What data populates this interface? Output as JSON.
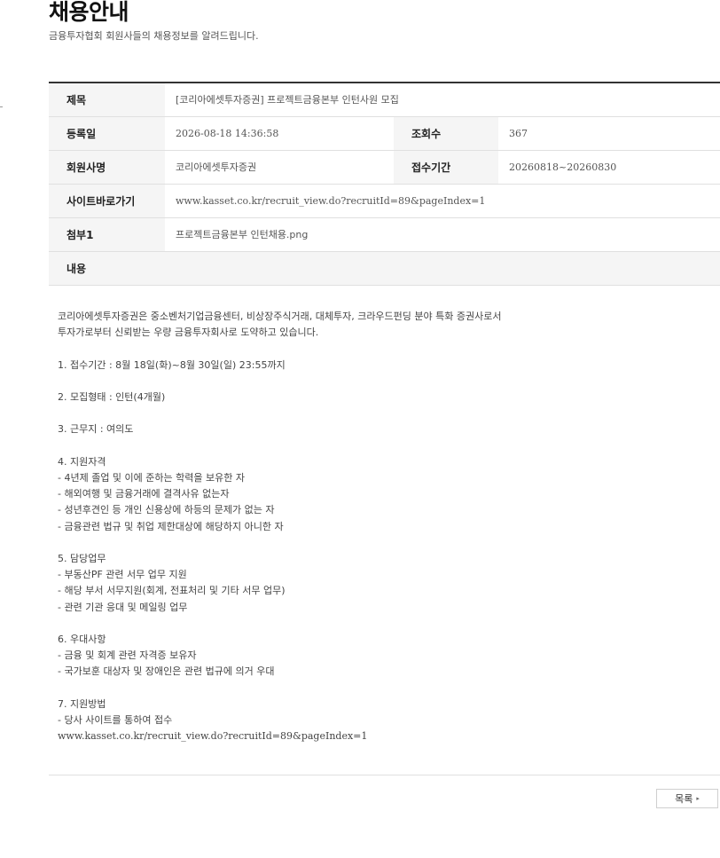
{
  "header": {
    "title": "채용안내",
    "subtitle": "금융투자협회 회원사들의 채용정보를 알려드립니다."
  },
  "detail": {
    "title_label": "제목",
    "title_value": "[코리아에셋투자증권] 프로젝트금융본부 인턴사원 모집",
    "date_label": "등록일",
    "date_value": "2026-08-18 14:36:58",
    "views_label": "조회수",
    "views_value": "367",
    "company_label": "회원사명",
    "company_value": "코리아에셋투자증권",
    "period_label": "접수기간",
    "period_value": "20260818~20260830",
    "site_label": "사이트바로가기",
    "site_value": "www.kasset.co.kr/recruit_view.do?recruitId=89&pageIndex=1",
    "attach_label": "첨부1",
    "attach_value": "프로젝트금융본부 인턴채용.png",
    "content_label": "내용"
  },
  "content": {
    "intro_1": "코리아에셋투자증권은 중소벤처기업금융센터, 비상장주식거래, 대체투자, 크라우드펀딩 분야 특화 증권사로서",
    "intro_2": "투자가로부터 신뢰받는 우량 금융투자회사로 도약하고 있습니다.",
    "s1": "1. 접수기간 : 8월 18일(화)~8월 30일(일) 23:55까지",
    "s2": "2. 모집형태 : 인턴(4개월)",
    "s3": "3. 근무지 : 여의도",
    "s4_title": "4. 지원자격",
    "s4_1": "- 4년제 졸업 및 이에 준하는 학력을 보유한 자",
    "s4_2": "- 해외여행 및 금융거래에 결격사유 없는자",
    "s4_3": "- 성년후견인 등 개인 신용상에 하등의 문제가 없는 자",
    "s4_4": "- 금융관련 법규 및 취업 제한대상에 해당하지 아니한 자",
    "s5_title": "5. 담당업무",
    "s5_1": "- 부동산PF 관련 서무 업무 지원",
    "s5_2": "- 해당 부서 서무지원(회계, 전표처리 및 기타 서무 업무)",
    "s5_3": "- 관련 기관 응대 및 메일링 업무",
    "s6_title": "6. 우대사항",
    "s6_1": "- 금융 및 회계 관련 자격증 보유자",
    "s6_2": "- 국가보훈 대상자 및 장애인은 관련 법규에 의거 우대",
    "s7_title": "7. 지원방법",
    "s7_1": "- 당사 사이트를 통하여 접수",
    "s7_2": "www.kasset.co.kr/recruit_view.do?recruitId=89&pageIndex=1"
  },
  "footer": {
    "list_button": "목록",
    "list_arrow": "▸"
  }
}
